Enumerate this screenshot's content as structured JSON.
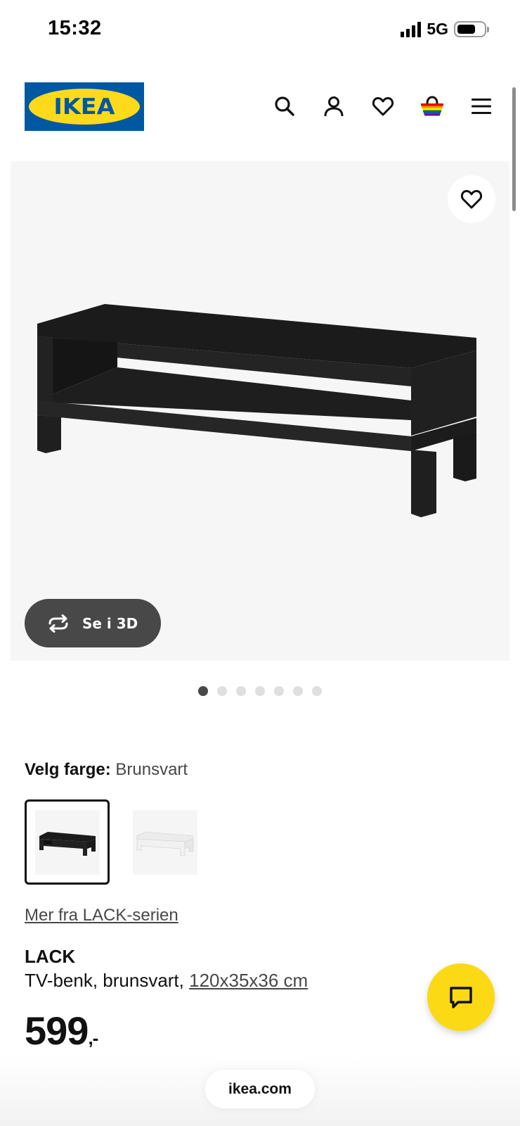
{
  "status_bar": {
    "time": "15:32",
    "network": "5G",
    "battery_level": 0.7
  },
  "header": {
    "logo_text": "IKEA",
    "logo_colors": {
      "blue": "#0058a3",
      "yellow": "#ffda1a"
    },
    "icons": [
      "search-icon",
      "account-icon",
      "wishlist-icon",
      "basket-icon",
      "menu-icon"
    ]
  },
  "hero": {
    "button_3d_label": "Se i 3D",
    "image_count": 7,
    "active_image_index": 0
  },
  "color_selector": {
    "label": "Velg farge:",
    "selected_value": "Brunsvart",
    "options": [
      "Brunsvart",
      "Hvit"
    ]
  },
  "product": {
    "series_link": "Mer fra LACK-serien",
    "name": "LACK",
    "description": "TV-benk, brunsvart, ",
    "dimensions": "120x35x36 cm",
    "price": "599",
    "price_suffix": ",-"
  },
  "browser": {
    "url": "ikea.com"
  },
  "colors": {
    "accent_yellow": "#fbd914",
    "dark_gray": "#484848"
  }
}
